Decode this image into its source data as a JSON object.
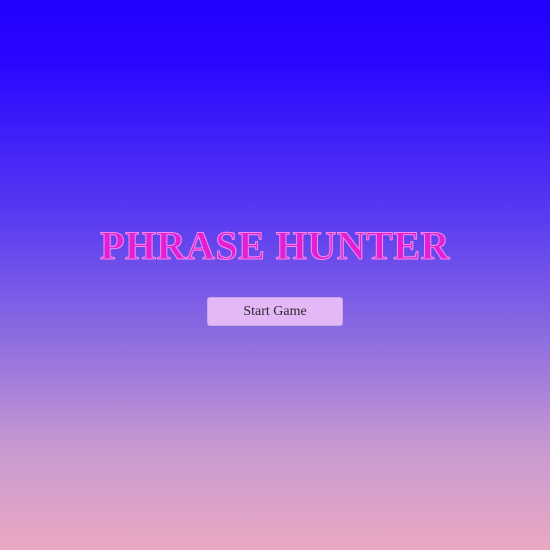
{
  "game": {
    "title": "PHRASE HUNTER",
    "start_button_label": "Start Game"
  },
  "colors": {
    "background_top": "#2200ff",
    "background_bottom": "#eaa9c2",
    "title_color": "#e21fd6",
    "title_outline": "#f58be8",
    "button_bg": "#e4b8f6"
  }
}
